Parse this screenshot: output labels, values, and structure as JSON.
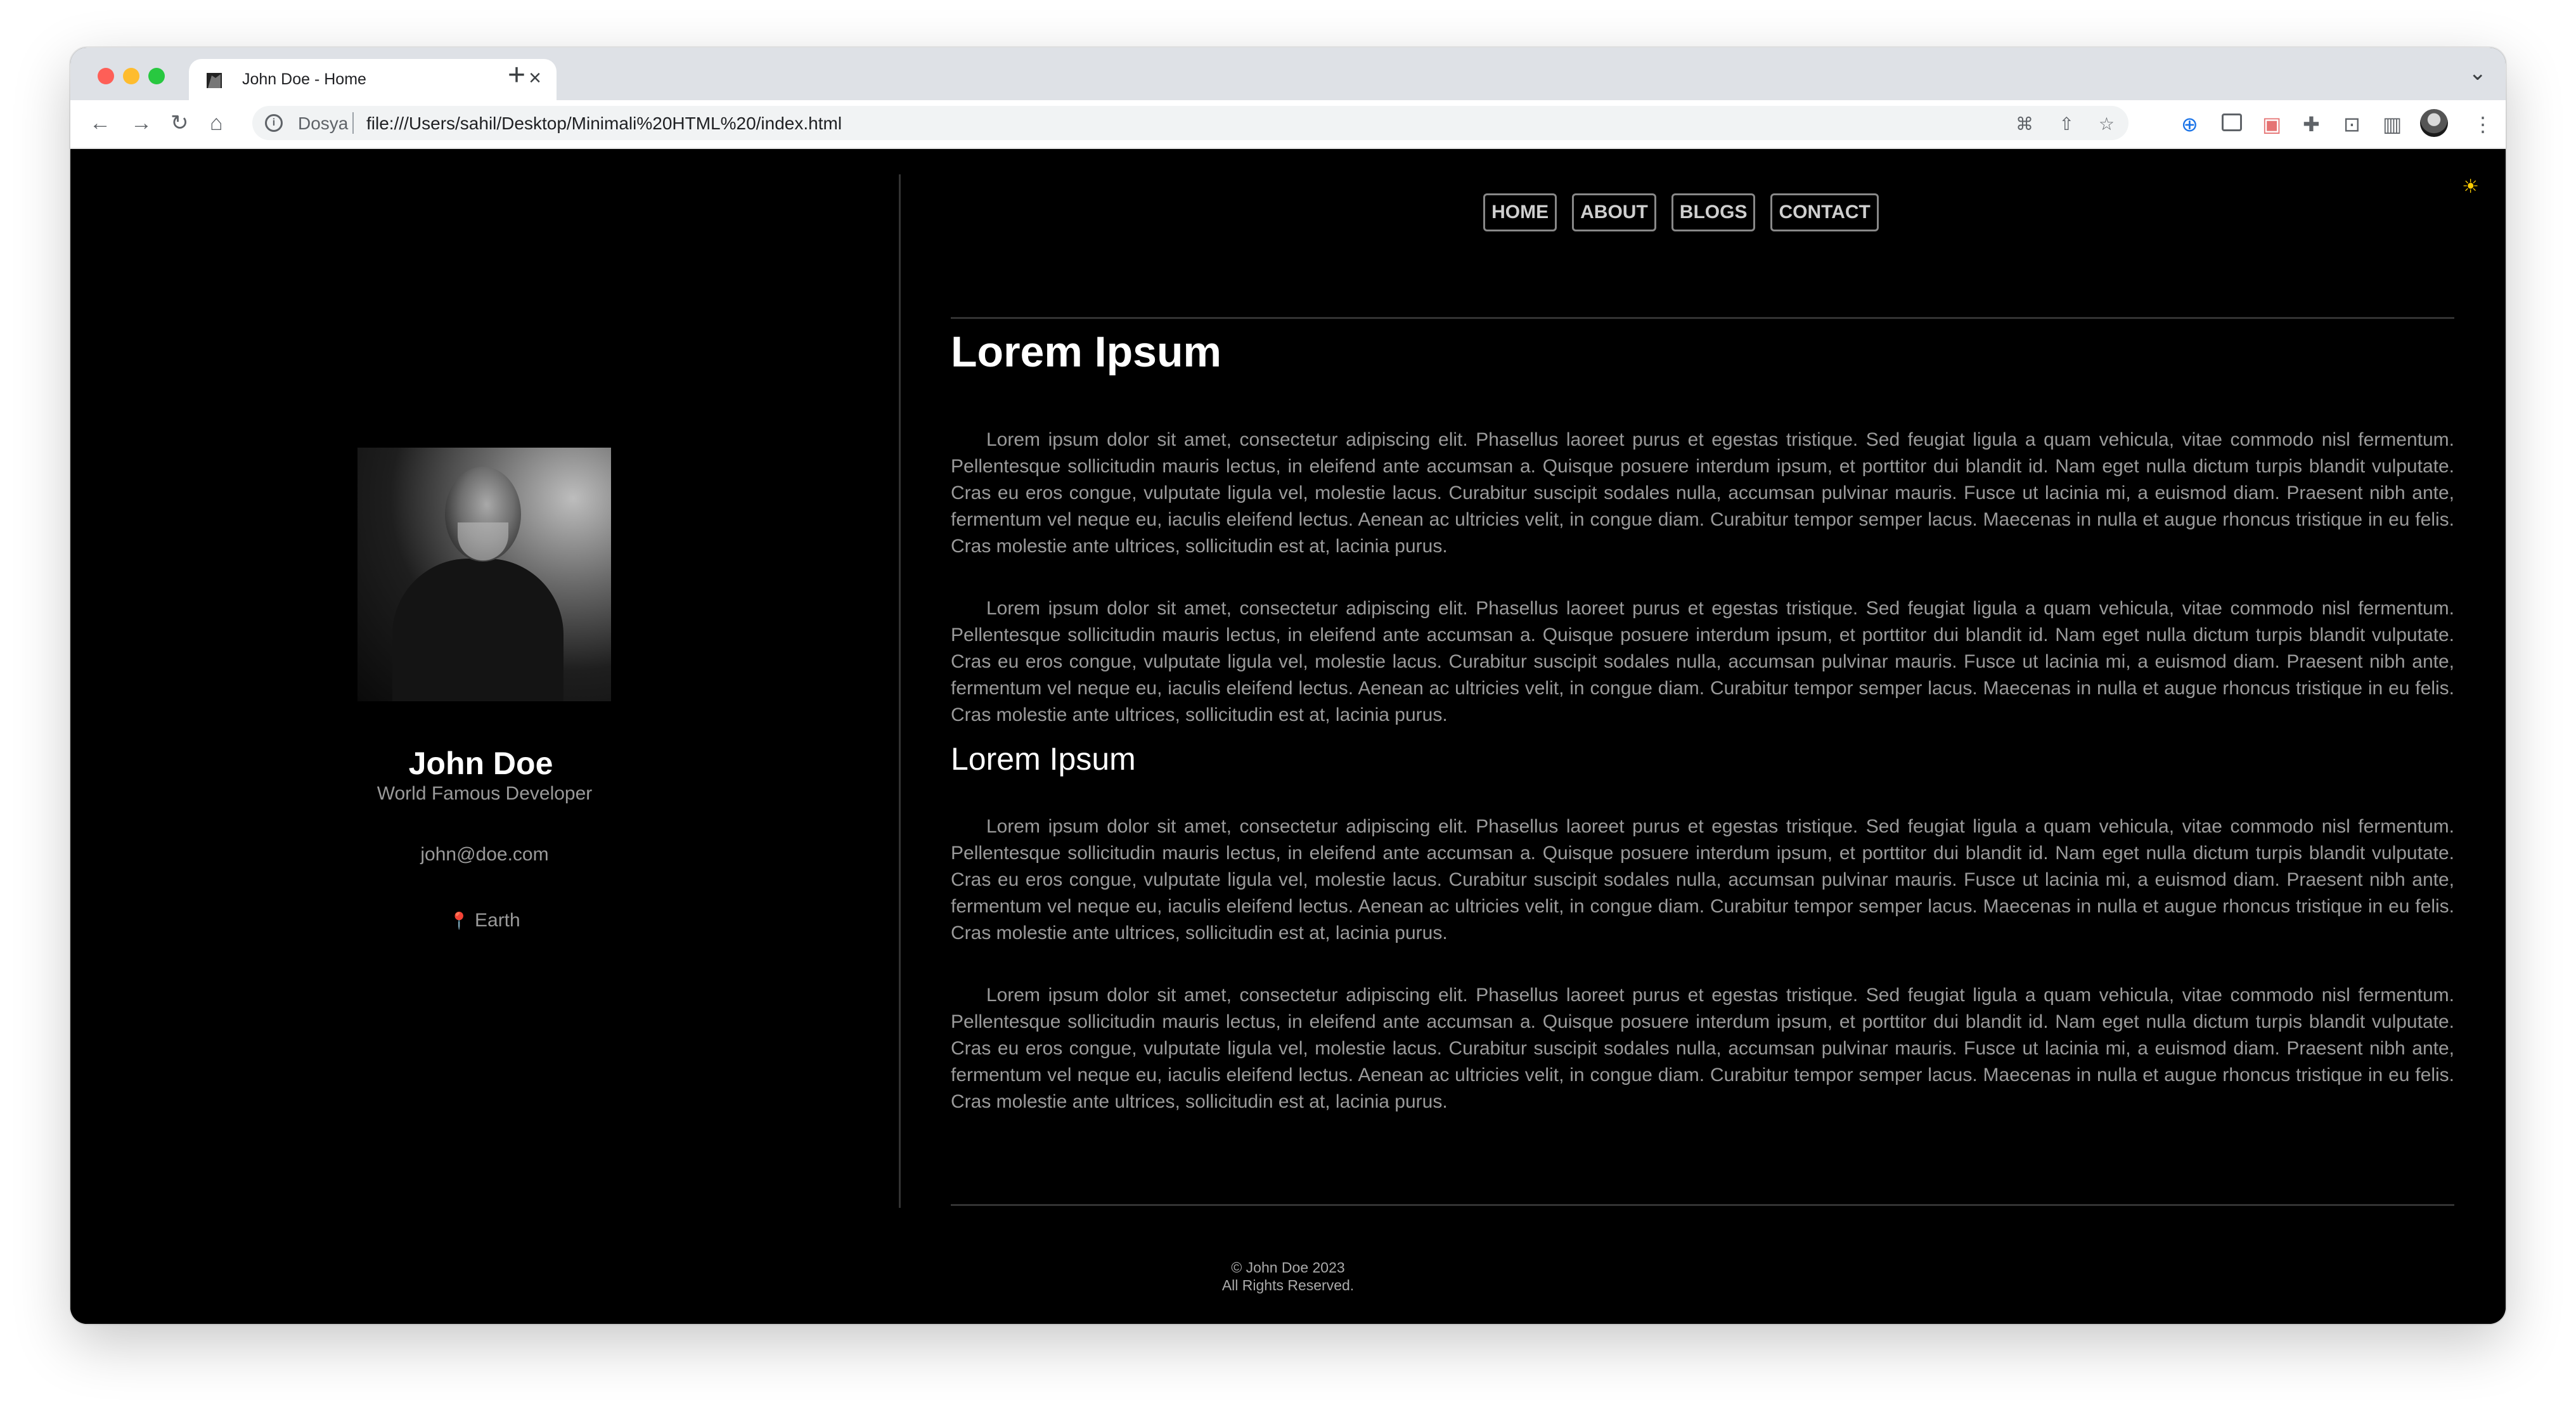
{
  "browser": {
    "tab_title": "John Doe - Home",
    "site_label": "Dosya",
    "url": "file:///Users/sahil/Desktop/Minimali%20HTML%20/index.html"
  },
  "nav": {
    "items": [
      "HOME",
      "ABOUT",
      "BLOGS",
      "CONTACT"
    ]
  },
  "profile": {
    "name": "John Doe",
    "title": "World Famous Developer",
    "email": "john@doe.com",
    "location": "Earth"
  },
  "content": {
    "heading": "Lorem Ipsum",
    "subheading": "Lorem Ipsum",
    "paragraph_1": "Lorem ipsum dolor sit amet, consectetur adipiscing elit. Phasellus laoreet purus et egestas tristique. Sed feugiat ligula a quam vehicula, vitae commodo nisl fermentum. Pellentesque sollicitudin mauris lectus, in eleifend ante accumsan a. Quisque posuere interdum ipsum, et porttitor dui blandit id. Nam eget nulla dictum turpis blandit vulputate. Cras eu eros congue, vulputate ligula vel, molestie lacus. Curabitur suscipit sodales nulla, accumsan pulvinar mauris. Fusce ut lacinia mi, a euismod diam. Praesent nibh ante, fermentum vel neque eu, iaculis eleifend lectus. Aenean ac ultricies velit, in congue diam. Curabitur tempor semper lacus. Maecenas in nulla et augue rhoncus tristique in eu felis. Cras molestie ante ultrices, sollicitudin est at, lacinia purus.",
    "paragraph_2": "Lorem ipsum dolor sit amet, consectetur adipiscing elit. Phasellus laoreet purus et egestas tristique. Sed feugiat ligula a quam vehicula, vitae commodo nisl fermentum. Pellentesque sollicitudin mauris lectus, in eleifend ante accumsan a. Quisque posuere interdum ipsum, et porttitor dui blandit id. Nam eget nulla dictum turpis blandit vulputate. Cras eu eros congue, vulputate ligula vel, molestie lacus. Curabitur suscipit sodales nulla, accumsan pulvinar mauris. Fusce ut lacinia mi, a euismod diam. Praesent nibh ante, fermentum vel neque eu, iaculis eleifend lectus. Aenean ac ultricies velit, in congue diam. Curabitur tempor semper lacus. Maecenas in nulla et augue rhoncus tristique in eu felis. Cras molestie ante ultrices, sollicitudin est at, lacinia purus.",
    "paragraph_3": "Lorem ipsum dolor sit amet, consectetur adipiscing elit. Phasellus laoreet purus et egestas tristique. Sed feugiat ligula a quam vehicula, vitae commodo nisl fermentum. Pellentesque sollicitudin mauris lectus, in eleifend ante accumsan a. Quisque posuere interdum ipsum, et porttitor dui blandit id. Nam eget nulla dictum turpis blandit vulputate. Cras eu eros congue, vulputate ligula vel, molestie lacus. Curabitur suscipit sodales nulla, accumsan pulvinar mauris. Fusce ut lacinia mi, a euismod diam. Praesent nibh ante, fermentum vel neque eu, iaculis eleifend lectus. Aenean ac ultricies velit, in congue diam. Curabitur tempor semper lacus. Maecenas in nulla et augue rhoncus tristique in eu felis. Cras molestie ante ultrices, sollicitudin est at, lacinia purus.",
    "paragraph_4": "Lorem ipsum dolor sit amet, consectetur adipiscing elit. Phasellus laoreet purus et egestas tristique. Sed feugiat ligula a quam vehicula, vitae commodo nisl fermentum. Pellentesque sollicitudin mauris lectus, in eleifend ante accumsan a. Quisque posuere interdum ipsum, et porttitor dui blandit id. Nam eget nulla dictum turpis blandit vulputate. Cras eu eros congue, vulputate ligula vel, molestie lacus. Curabitur suscipit sodales nulla, accumsan pulvinar mauris. Fusce ut lacinia mi, a euismod diam. Praesent nibh ante, fermentum vel neque eu, iaculis eleifend lectus. Aenean ac ultricies velit, in congue diam. Curabitur tempor semper lacus. Maecenas in nulla et augue rhoncus tristique in eu felis. Cras molestie ante ultrices, sollicitudin est at, lacinia purus."
  },
  "footer": {
    "copyright": "© John Doe 2023",
    "rights": "All Rights Reserved."
  },
  "icons": {
    "theme_toggle": "sun-icon",
    "location": "map-pin-icon"
  },
  "colors": {
    "page_background": "#000000",
    "text_muted": "#9a9a9a",
    "heading": "#ffffff",
    "sun": "#ffcc00"
  }
}
